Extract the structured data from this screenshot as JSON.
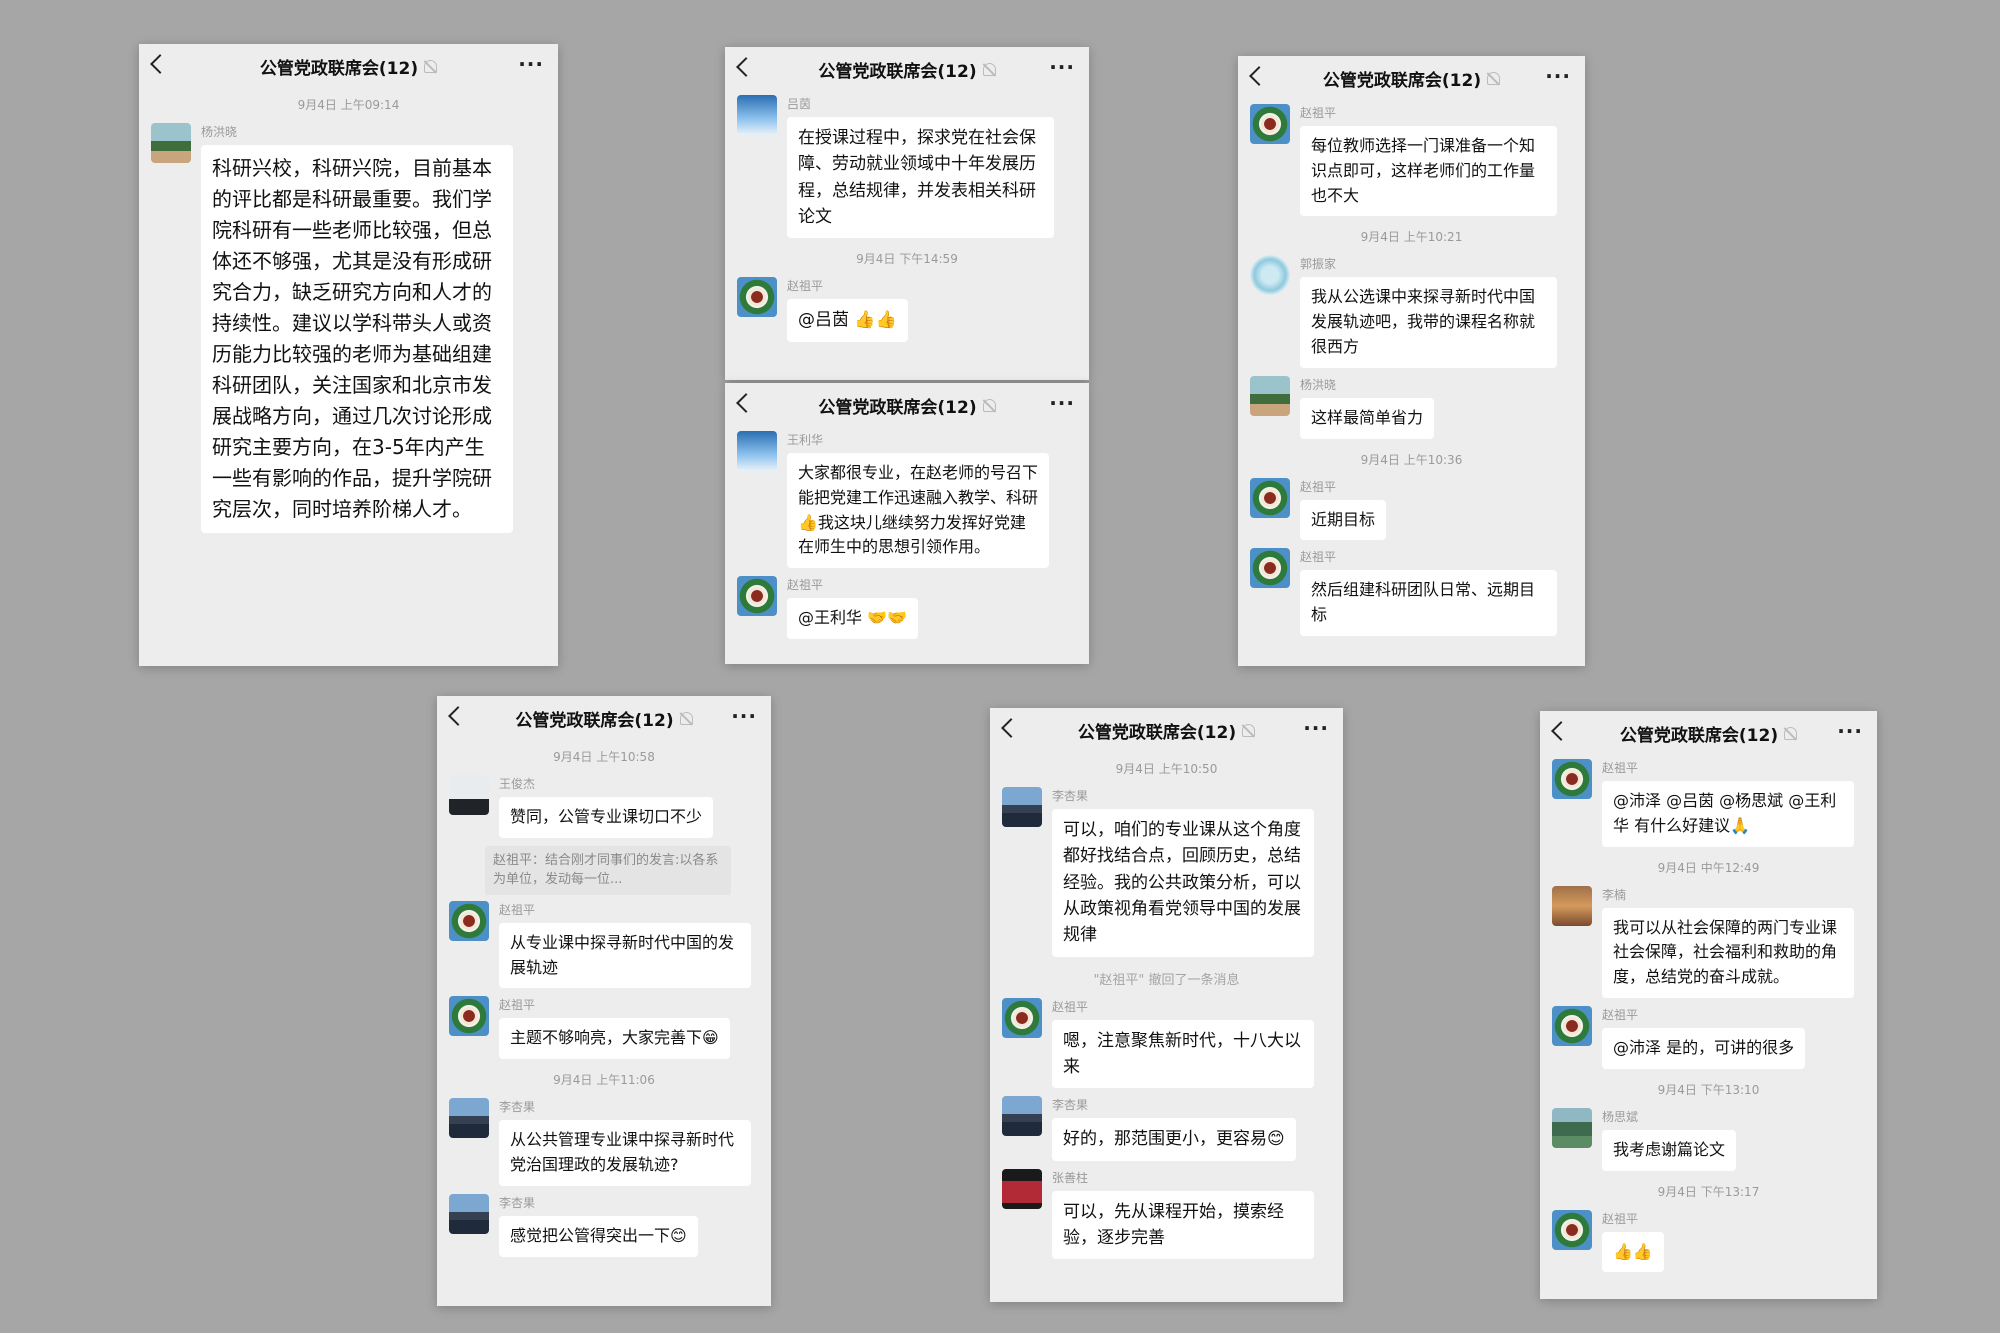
{
  "chat_title": "公管党政联席会(12)",
  "screens": [
    {
      "messages": [
        {
          "type": "time",
          "text": "9月4日 上午09:14"
        },
        {
          "type": "msg",
          "sender": "杨洪晓",
          "avatar": "tree",
          "text": "科研兴校，科研兴院，目前基本的评比都是科研最重要。我们学院科研有一些老师比较强，但总体还不够强，尤其是没有形成研究合力，缺乏研究方向和人才的持续性。建议以学科带头人或资历能力比较强的老师为基础组建科研团队，关注国家和北京市发展战略方向，通过几次讨论形成研究主要方向，在3-5年内产生一些有影响的作品，提升学院研究层次，同时培养阶梯人才。"
        }
      ]
    },
    {
      "messages": [
        {
          "type": "msg",
          "sender": "吕茵",
          "avatar": "sky",
          "text": "在授课过程中，探求党在社会保障、劳动就业领域中十年发展历程，总结规律，并发表相关科研论文"
        },
        {
          "type": "time",
          "text": "9月4日 下午14:59"
        },
        {
          "type": "msg",
          "sender": "赵祖平",
          "avatar": "seal",
          "text": "@吕茵 👍👍"
        }
      ]
    },
    {
      "messages": [
        {
          "type": "msg",
          "sender": "王利华",
          "avatar": "sky",
          "text": "大家都很专业，在赵老师的号召下能把党建工作迅速融入教学、科研👍我这块儿继续努力发挥好党建在师生中的思想引领作用。"
        },
        {
          "type": "msg",
          "sender": "赵祖平",
          "avatar": "seal",
          "text": "@王利华 🤝🤝"
        }
      ]
    },
    {
      "messages": [
        {
          "type": "msg",
          "sender": "赵祖平",
          "avatar": "seal",
          "text": "每位教师选择一门课准备一个知识点即可，这样老师们的工作量也不大"
        },
        {
          "type": "time",
          "text": "9月4日 上午10:21"
        },
        {
          "type": "msg",
          "sender": "郭振家",
          "avatar": "globe",
          "text": "我从公选课中来探寻新时代中国发展轨迹吧，我带的课程名称就很西方"
        },
        {
          "type": "msg",
          "sender": "杨洪晓",
          "avatar": "tree",
          "text": "这样最简单省力"
        },
        {
          "type": "time",
          "text": "9月4日 上午10:36"
        },
        {
          "type": "msg",
          "sender": "赵祖平",
          "avatar": "seal",
          "text": "近期目标"
        },
        {
          "type": "msg",
          "sender": "赵祖平",
          "avatar": "seal",
          "text": "然后组建科研团队日常、远期目标"
        }
      ]
    },
    {
      "messages": [
        {
          "type": "time",
          "text": "9月4日 上午10:58"
        },
        {
          "type": "msg",
          "sender": "王俊杰",
          "avatar": "palm",
          "text": "赞同，公管专业课切口不少"
        },
        {
          "type": "quote",
          "text": "赵祖平：结合刚才同事们的发言:以各系为单位，发动每一位..."
        },
        {
          "type": "msg",
          "sender": "赵祖平",
          "avatar": "seal",
          "text": "从专业课中探寻新时代中国的发展轨迹"
        },
        {
          "type": "msg",
          "sender": "赵祖平",
          "avatar": "seal",
          "text": "主题不够响亮，大家完善下😁"
        },
        {
          "type": "time",
          "text": "9月4日 上午11:06"
        },
        {
          "type": "msg",
          "sender": "李杏果",
          "avatar": "city",
          "text": "从公共管理专业课中探寻新时代党治国理政的发展轨迹?"
        },
        {
          "type": "msg",
          "sender": "李杏果",
          "avatar": "city",
          "text": "感觉把公管得突出一下😊"
        }
      ]
    },
    {
      "messages": [
        {
          "type": "time",
          "text": "9月4日 上午10:50"
        },
        {
          "type": "msg",
          "sender": "李杏果",
          "avatar": "city",
          "text": "可以，咱们的专业课从这个角度都好找结合点，回顾历史，总结经验。我的公共政策分析，可以从政策视角看党领导中国的发展规律"
        },
        {
          "type": "recall",
          "text": "\"赵祖平\" 撤回了一条消息"
        },
        {
          "type": "msg",
          "sender": "赵祖平",
          "avatar": "seal",
          "text": "嗯，注意聚焦新时代，十八大以来"
        },
        {
          "type": "msg",
          "sender": "李杏果",
          "avatar": "city",
          "text": "好的，那范围更小，更容易😊"
        },
        {
          "type": "msg",
          "sender": "张善柱",
          "avatar": "red",
          "text": "可以，先从课程开始，摸索经验，逐步完善"
        }
      ]
    },
    {
      "messages": [
        {
          "type": "msg",
          "sender": "赵祖平",
          "avatar": "seal",
          "text": "@沛泽 @吕茵 @杨思斌 @王利华  有什么好建议🙏"
        },
        {
          "type": "time",
          "text": "9月4日 中午12:49"
        },
        {
          "type": "msg",
          "sender": "李楠",
          "avatar": "warm",
          "text": "我可以从社会保障的两门专业课社会保障，社会福利和救助的角度，总结党的奋斗成就。"
        },
        {
          "type": "msg",
          "sender": "赵祖平",
          "avatar": "seal",
          "text": "@沛泽  是的，可讲的很多"
        },
        {
          "type": "time",
          "text": "9月4日 下午13:10"
        },
        {
          "type": "msg",
          "sender": "杨思斌",
          "avatar": "green",
          "text": "我考虑谢篇论文"
        },
        {
          "type": "time",
          "text": "9月4日 下午13:17"
        },
        {
          "type": "msg",
          "sender": "赵祖平",
          "avatar": "seal",
          "text": "👍👍"
        }
      ]
    }
  ]
}
